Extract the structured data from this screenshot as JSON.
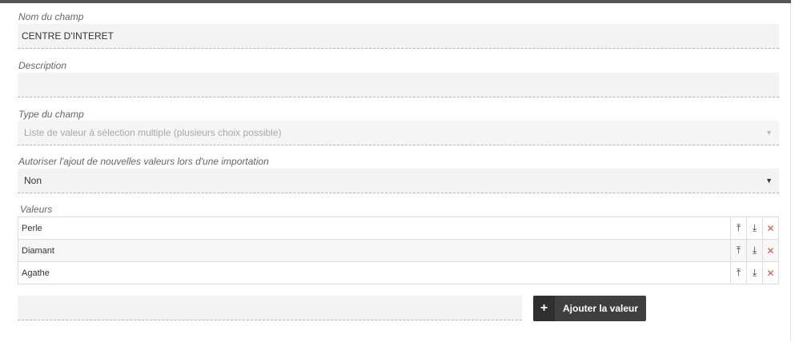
{
  "fields": {
    "name": {
      "label": "Nom du champ",
      "value": "CENTRE D'INTERET"
    },
    "description": {
      "label": "Description",
      "value": ""
    },
    "type": {
      "label": "Type du champ",
      "value": "Liste de valeur à sélection multiple (plusieurs choix possible)"
    },
    "allow_import": {
      "label": "Autoriser l'ajout de nouvelles valeurs lors d'une importation",
      "value": "Non"
    }
  },
  "values_section": {
    "label": "Valeurs",
    "rows": [
      {
        "label": "Perle"
      },
      {
        "label": "Diamant"
      },
      {
        "label": "Agathe"
      }
    ],
    "icons": {
      "move_top": "move-to-top-icon",
      "move_bottom": "move-to-bottom-icon",
      "delete": "delete-x-icon"
    },
    "icon_glyphs": {
      "move_top": "⤒",
      "move_bottom": "⤓",
      "delete": "✕"
    }
  },
  "add_value": {
    "input_value": "",
    "button_label": "Ajouter la valeur",
    "button_icon": "+"
  },
  "colors": {
    "header_bar": "#555555",
    "field_bg": "#f3f3f3",
    "button_bg": "#3f3f3f",
    "delete": "#d9534f"
  }
}
